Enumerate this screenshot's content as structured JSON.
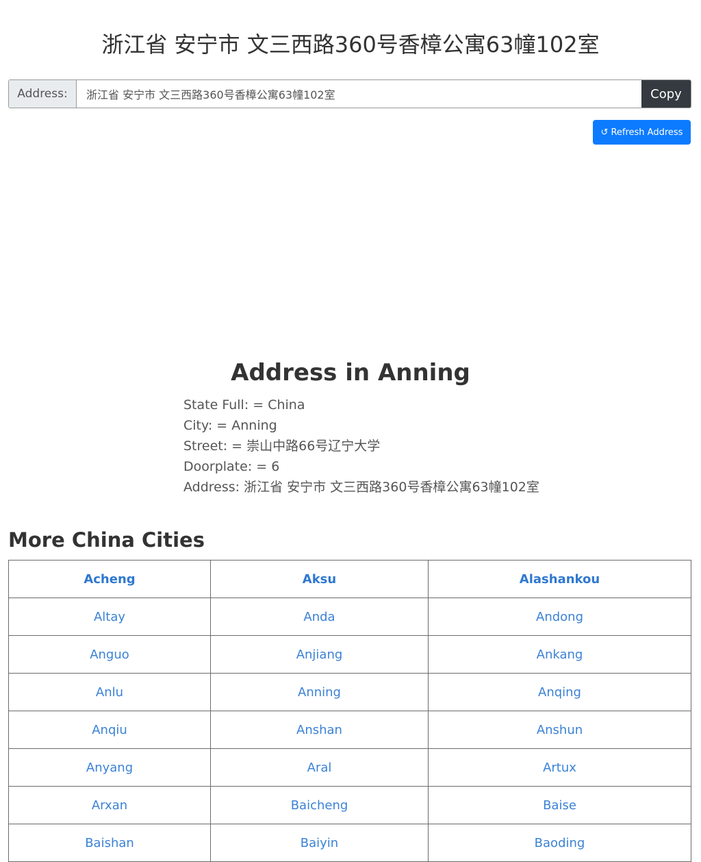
{
  "header": {
    "title": "浙江省 安宁市 文三西路360号香樟公寓63幢102室"
  },
  "address_bar": {
    "label": "Address:",
    "value": "浙江省 安宁市 文三西路360号香樟公寓63幢102室",
    "copy_label": "Copy"
  },
  "refresh": {
    "icon": "refresh-icon",
    "label": "Refresh Address"
  },
  "details": {
    "title": "Address in Anning",
    "state_line": "State Full: = China",
    "city_line": "City: = Anning",
    "street_line": "Street: = 崇山中路66号辽宁大学",
    "doorplate_line": "Doorplate: = 6",
    "address_line": "Address: 浙江省 安宁市 文三西路360号香樟公寓63幢102室"
  },
  "more": {
    "title": "More China Cities",
    "rows": [
      [
        "Acheng",
        "Aksu",
        "Alashankou"
      ],
      [
        "Altay",
        "Anda",
        "Andong"
      ],
      [
        "Anguo",
        "Anjiang",
        "Ankang"
      ],
      [
        "Anlu",
        "Anning",
        "Anqing"
      ],
      [
        "Anqiu",
        "Anshan",
        "Anshun"
      ],
      [
        "Anyang",
        "Aral",
        "Artux"
      ],
      [
        "Arxan",
        "Baicheng",
        "Baise"
      ],
      [
        "Baishan",
        "Baiyin",
        "Baoding"
      ]
    ]
  },
  "colors": {
    "copy_bg": "#343a40",
    "refresh_bg": "#0d7bff",
    "link": "#3b82d6"
  }
}
